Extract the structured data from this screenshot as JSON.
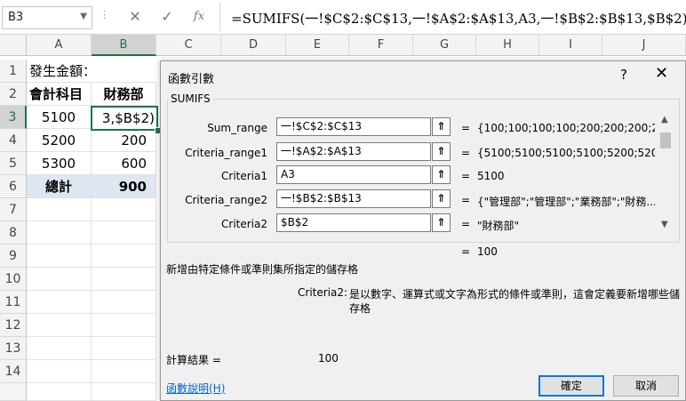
{
  "formula_bar": {
    "name_box": "B3",
    "cancel_icon": "✕",
    "enter_icon": "✓",
    "fx_label": "fx",
    "formula": "=SUMIFS(一!$C$2:$C$13,一!$A$2:$A$13,A3,一!$B$2:$B$13,$B$2)"
  },
  "columns": [
    "A",
    "B",
    "C",
    "D",
    "E",
    "F",
    "G",
    "H",
    "I",
    "J"
  ],
  "rows": [
    "1",
    "2",
    "3",
    "4",
    "5",
    "6",
    "7",
    "8",
    "9",
    "10",
    "11",
    "12",
    "13",
    "14"
  ],
  "cells": {
    "a1": "發生金額：",
    "a2": "會計科目",
    "b2": "財務部",
    "a3": "5100",
    "b3": "3,$B$2)",
    "a4": "5200",
    "b4": "200",
    "a5": "5300",
    "b5": "600",
    "a6": "總計",
    "b6": "900"
  },
  "dialog": {
    "title": "函數引數",
    "help": "?",
    "close": "✕",
    "function_name": "SUMIFS",
    "args": [
      {
        "label": "Sum_range",
        "value": "一!$C$2:$C$13",
        "result": "{100;100;100;100;200;200;200;200;"
      },
      {
        "label": "Criteria_range1",
        "value": "一!$A$2:$A$13",
        "result": "{5100;5100;5100;5100;5200;520..."
      },
      {
        "label": "Criteria1",
        "value": "A3",
        "result": "5100"
      },
      {
        "label": "Criteria_range2",
        "value": "一!$B$2:$B$13",
        "result": "{\"管理部\";\"管理部\";\"業務部\";\"財務..."
      },
      {
        "label": "Criteria2",
        "value": "$B$2",
        "result": "\"財務部\""
      }
    ],
    "eq": "=",
    "ref_icon": "⇑",
    "overall_result": "100",
    "description": "新增由特定條件或準則集所指定的儲存格",
    "arg_help_label": "Criteria2:",
    "arg_help_text_1": "是以數字、運算式或文字為形式的條件或準則，這會定義要新增哪些儲",
    "arg_help_text_2": "存格",
    "calc_label": "計算結果 =",
    "calc_value": "100",
    "help_link": "函數說明(H)",
    "ok": "確定",
    "cancel": "取消"
  }
}
